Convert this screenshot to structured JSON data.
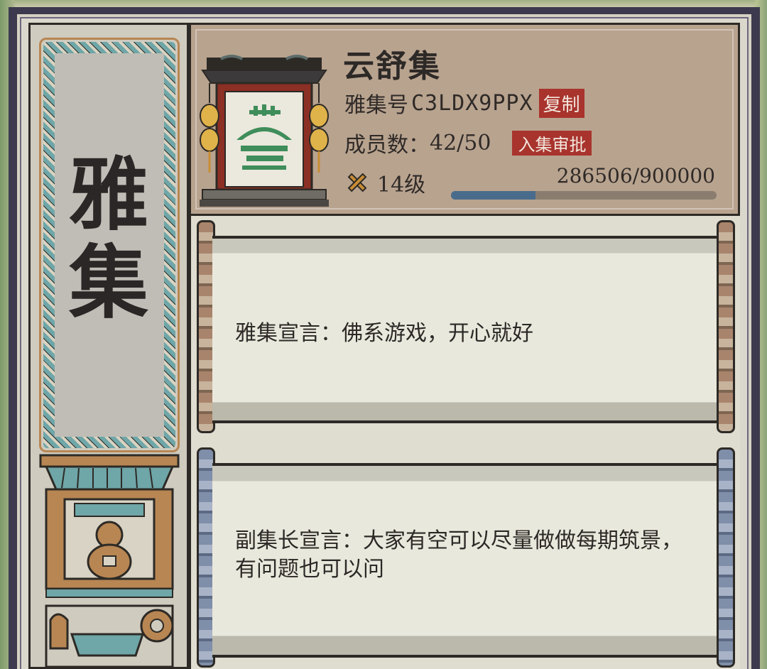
{
  "banner": {
    "title_line1": "雅",
    "title_line2": "集"
  },
  "guild": {
    "name": "云舒集",
    "id_label": "雅集号",
    "id_value": "C3LDX9PPX",
    "copy_label": "复制",
    "members_label": "成员数：",
    "members_value": "42/50",
    "approve_label": "入集审批",
    "level_label": "14级",
    "exp_text": "286506/900000",
    "exp_progress": 0.318
  },
  "declarations": {
    "guild": "雅集宣言：佛系游戏，开心就好",
    "vice": "副集长宣言：大家有空可以尽量做做每期筑景，有问题也可以问"
  },
  "colors": {
    "tag_red": "#a8342d",
    "exp_blue": "#4a6c8c",
    "frame_dark": "#3d3a4f",
    "teal_accent": "#6fa6a8"
  },
  "icons": {
    "level": "crossed-sticks-icon",
    "emblem": "guild-gate-emblem-icon"
  }
}
